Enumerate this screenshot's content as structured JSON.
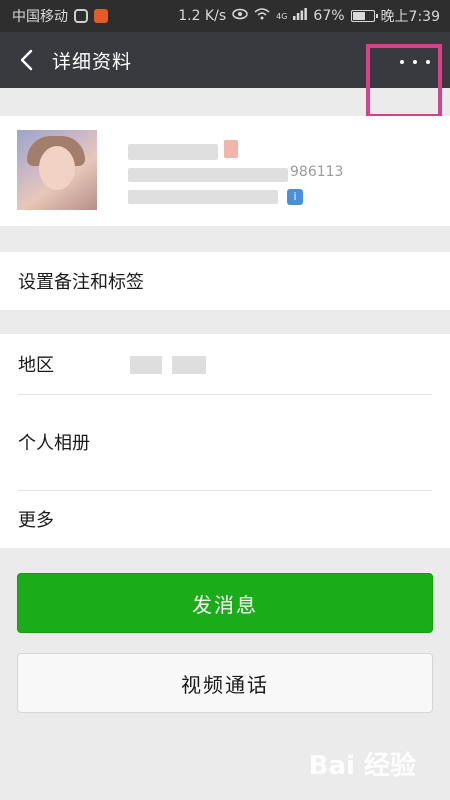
{
  "status_bar": {
    "carrier": "中国移动",
    "speed": "1.2 K/s",
    "network": "4G",
    "battery": "67%",
    "battery_level": 0.67,
    "time": "晚上7:39"
  },
  "header": {
    "title": "详细资料",
    "back_icon": "chevron-left-icon",
    "more_icon": "more-horizontal-icon"
  },
  "profile": {
    "id_fragment": "986113"
  },
  "menu": {
    "remark_label": "设置备注和标签",
    "region_label": "地区",
    "album_label": "个人相册",
    "more_label": "更多"
  },
  "actions": {
    "send_message": "发消息",
    "video_call": "视频通话"
  },
  "colors": {
    "title_bar": "#393a3f",
    "primary_button": "#1aad19",
    "highlight": "#d7418a",
    "background": "#ebebeb"
  },
  "watermark": "Bai 经验"
}
